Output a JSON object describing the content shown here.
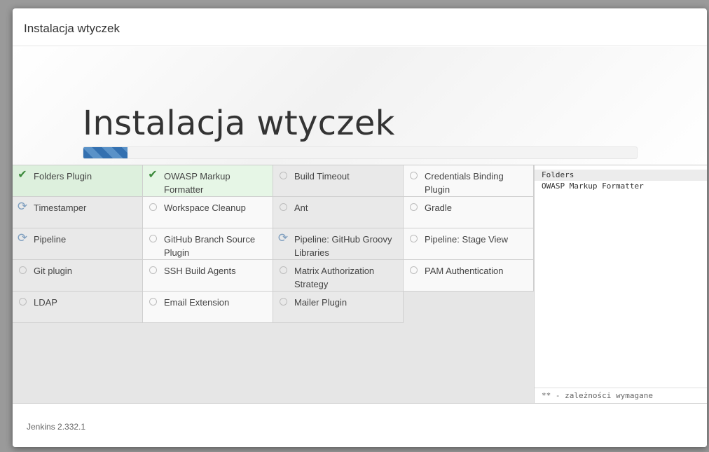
{
  "dialog": {
    "title": "Instalacja wtyczek"
  },
  "hero": {
    "title": "Instalacja wtyczek",
    "progress": 0.08
  },
  "plugins": [
    {
      "name": "Folders Plugin",
      "status": "installed",
      "shade": "done"
    },
    {
      "name": "OWASP Markup Formatter",
      "status": "installed",
      "shade": "done light"
    },
    {
      "name": "Build Timeout",
      "status": "pending",
      "shade": "g"
    },
    {
      "name": "Credentials Binding Plugin",
      "status": "pending",
      "shade": "w"
    },
    {
      "name": "Timestamper",
      "status": "installing",
      "shade": "g"
    },
    {
      "name": "Workspace Cleanup",
      "status": "pending",
      "shade": "w"
    },
    {
      "name": "Ant",
      "status": "pending",
      "shade": "g"
    },
    {
      "name": "Gradle",
      "status": "pending",
      "shade": "w"
    },
    {
      "name": "Pipeline",
      "status": "installing",
      "shade": "g"
    },
    {
      "name": "GitHub Branch Source Plugin",
      "status": "pending",
      "shade": "w"
    },
    {
      "name": "Pipeline: GitHub Groovy Libraries",
      "status": "installing",
      "shade": "g"
    },
    {
      "name": "Pipeline: Stage View",
      "status": "pending",
      "shade": "w"
    },
    {
      "name": "Git plugin",
      "status": "pending",
      "shade": "g"
    },
    {
      "name": "SSH Build Agents",
      "status": "pending",
      "shade": "w"
    },
    {
      "name": "Matrix Authorization Strategy",
      "status": "pending",
      "shade": "g"
    },
    {
      "name": "PAM Authentication",
      "status": "pending",
      "shade": "w"
    },
    {
      "name": "LDAP",
      "status": "pending",
      "shade": "g"
    },
    {
      "name": "Email Extension",
      "status": "pending",
      "shade": "w"
    },
    {
      "name": "Mailer Plugin",
      "status": "pending",
      "shade": "g"
    }
  ],
  "log": {
    "lines": [
      "Folders",
      "OWASP Markup Formatter"
    ],
    "footer": "** - zależności wymagane"
  },
  "footer": {
    "version": "Jenkins 2.332.1"
  },
  "colors": {
    "accent": "#3370b0",
    "installed_bg": "#ddf0dd",
    "check": "#3d8b3d",
    "spinner": "#7f9fbf"
  },
  "icons": {
    "installed": "check-icon",
    "installing": "refresh-icon",
    "pending": "pending-circle-icon"
  }
}
